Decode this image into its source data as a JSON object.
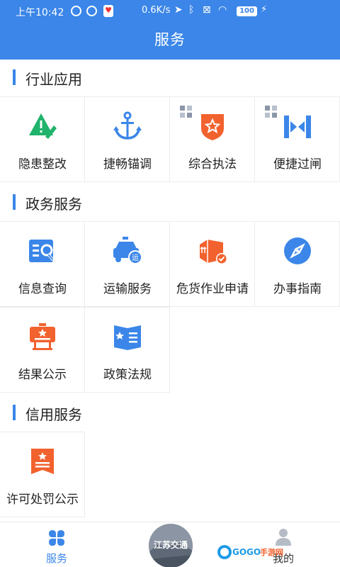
{
  "status_bar": {
    "time": "上午10:42",
    "network_speed": "0.6K/s",
    "battery": "100"
  },
  "header": {
    "title": "服务"
  },
  "sections": [
    {
      "title": "行业应用",
      "items": [
        {
          "label": "隐患整改",
          "icon": "warning-edit-icon"
        },
        {
          "label": "捷畅锚调",
          "icon": "anchor-icon"
        },
        {
          "label": "综合执法",
          "icon": "police-badge-icon"
        },
        {
          "label": "便捷过闸",
          "icon": "lock-gate-icon"
        }
      ]
    },
    {
      "title": "政务服务",
      "items": [
        {
          "label": "信息查询",
          "icon": "info-search-icon"
        },
        {
          "label": "运输服务",
          "icon": "transport-car-icon",
          "badge": "运"
        },
        {
          "label": "危货作业申请",
          "icon": "dangerous-goods-icon"
        },
        {
          "label": "办事指南",
          "icon": "compass-icon"
        },
        {
          "label": "结果公示",
          "icon": "result-board-icon"
        },
        {
          "label": "政策法规",
          "icon": "policy-book-icon"
        }
      ]
    },
    {
      "title": "信用服务",
      "items": [
        {
          "label": "许可处罚公示",
          "icon": "permit-penalty-icon"
        }
      ]
    }
  ],
  "tabbar": {
    "services_label": "服务",
    "center_label": "江苏交通",
    "mine_label": "我的"
  },
  "watermark": {
    "text": "GOGO手游网"
  },
  "colors": {
    "primary": "#3b86e8",
    "orange": "#f2622e",
    "green": "#1fb36b"
  }
}
